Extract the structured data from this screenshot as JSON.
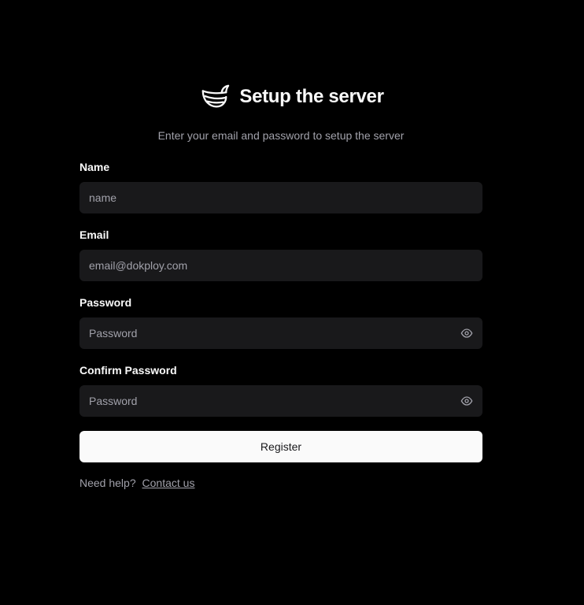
{
  "header": {
    "title": "Setup the server",
    "logo_icon": "whale-logo-icon"
  },
  "subtitle": "Enter your email and password to setup the server",
  "form": {
    "name": {
      "label": "Name",
      "placeholder": "name",
      "value": ""
    },
    "email": {
      "label": "Email",
      "placeholder": "email@dokploy.com",
      "value": ""
    },
    "password": {
      "label": "Password",
      "placeholder": "Password",
      "value": "",
      "toggle_icon": "eye-icon"
    },
    "confirm_password": {
      "label": "Confirm Password",
      "placeholder": "Password",
      "value": "",
      "toggle_icon": "eye-icon"
    },
    "submit_label": "Register"
  },
  "help": {
    "text": "Need help?",
    "link_text": "Contact us"
  },
  "colors": {
    "background": "#000000",
    "input_background": "#19191b",
    "primary_button": "#fafafa",
    "muted_text": "#a1a1aa"
  }
}
